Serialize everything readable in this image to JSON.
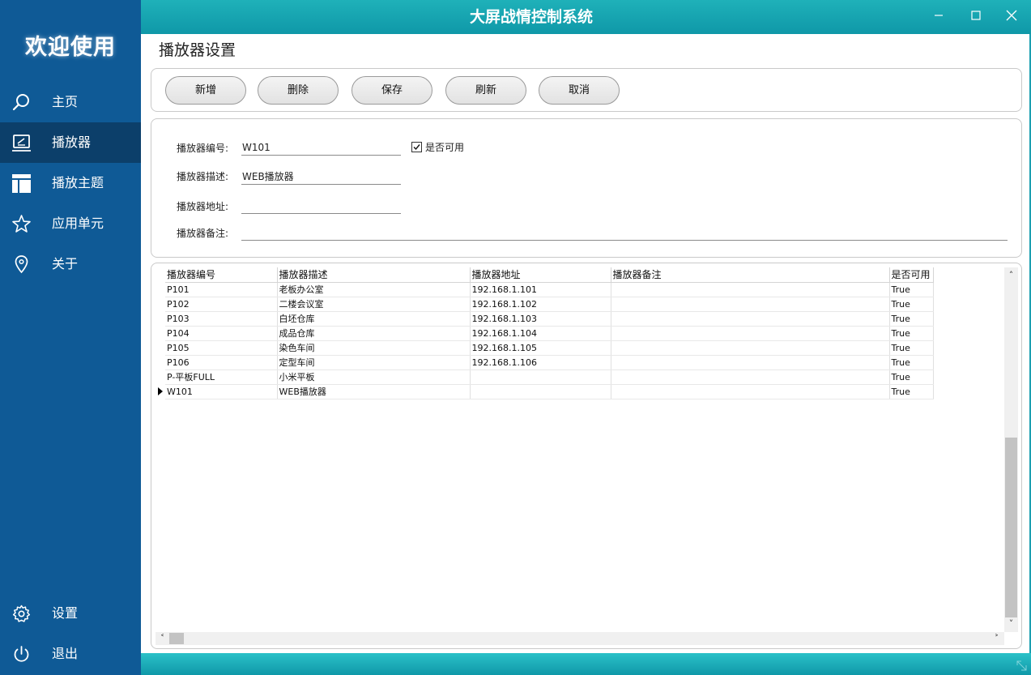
{
  "app": {
    "title": "大屏战情控制系统"
  },
  "sidebar": {
    "welcome": "欢迎使用",
    "items": [
      {
        "label": "主页",
        "icon": "search-icon"
      },
      {
        "label": "播放器",
        "icon": "player-icon",
        "active": true
      },
      {
        "label": "播放主题",
        "icon": "layout-icon"
      },
      {
        "label": "应用单元",
        "icon": "star-icon"
      },
      {
        "label": "关于",
        "icon": "location-pin-icon"
      }
    ],
    "bottom_items": [
      {
        "label": "设置",
        "icon": "gear-icon"
      },
      {
        "label": "退出",
        "icon": "power-icon"
      }
    ]
  },
  "page": {
    "title": "播放器设置"
  },
  "toolbar": {
    "buttons": [
      "新增",
      "删除",
      "保存",
      "刷新",
      "取消"
    ]
  },
  "form": {
    "code_label": "播放器编号:",
    "code_value": "W101",
    "enabled_label": "是否可用",
    "enabled_checked": true,
    "desc_label": "播放器描述:",
    "desc_value": "WEB播放器",
    "address_label": "播放器地址:",
    "address_value": "",
    "remark_label": "播放器备注:",
    "remark_value": ""
  },
  "grid": {
    "columns": [
      "播放器编号",
      "播放器描述",
      "播放器地址",
      "播放器备注",
      "是否可用"
    ],
    "rows": [
      [
        "P101",
        "老板办公室",
        "192.168.1.101",
        "",
        "True"
      ],
      [
        "P102",
        "二楼会议室",
        "192.168.1.102",
        "",
        "True"
      ],
      [
        "P103",
        "白坯仓库",
        "192.168.1.103",
        "",
        "True"
      ],
      [
        "P104",
        "成品仓库",
        "192.168.1.104",
        "",
        "True"
      ],
      [
        "P105",
        "染色车间",
        "192.168.1.105",
        "",
        "True"
      ],
      [
        "P106",
        "定型车间",
        "192.168.1.106",
        "",
        "True"
      ],
      [
        "P-平板FULL",
        "小米平板",
        "",
        "",
        "True"
      ],
      [
        "W101",
        "WEB播放器",
        "",
        "",
        "True"
      ]
    ],
    "selected_row": 7
  },
  "colors": {
    "sidebar": "#0f5a96",
    "sidebar_active": "#0c3f6a",
    "titlebar": "#1fb1b9"
  }
}
